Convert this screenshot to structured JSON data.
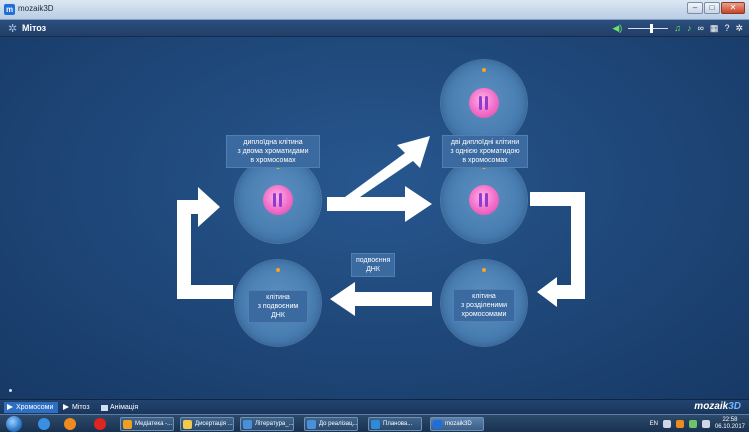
{
  "window": {
    "title": "mozaik3D",
    "min_label": "–",
    "max_label": "□",
    "close_label": "✕"
  },
  "app": {
    "heading": "Мітоз",
    "icons": {
      "settings": "gear-icon",
      "volume": "speaker-icon",
      "music": "music-note-icon",
      "link": "link-icon",
      "grid": "grid-icon",
      "help": "help-icon"
    },
    "volume_level": 0.55
  },
  "stage": {
    "labels": {
      "top_left": [
        "диплоїдна клітина",
        "з двома хроматидами",
        "в хромосомах"
      ],
      "top_right": [
        "дві диплоїдні клітини",
        "з однією хроматидою",
        "в хромосомах"
      ],
      "center": [
        "подвоєння",
        "ДНК"
      ],
      "bottom_left": [
        "клітина",
        "з подвоєним",
        "ДНК"
      ],
      "bottom_right": [
        "клітина",
        "з розділеними",
        "хромосомами"
      ]
    },
    "colors": {
      "arrow": "#ffffff",
      "nucleus": "#f26cc8",
      "chromosome": "#8f3ad0",
      "cell": "#4a7fb3",
      "marker": "#f5a623"
    }
  },
  "bottom_tabs": [
    {
      "label": "Хромосоми",
      "active": true
    },
    {
      "label": "Мітоз",
      "active": false
    },
    {
      "label": "Анімація",
      "active": false
    }
  ],
  "brand": {
    "name": "mozaik",
    "suffix": "3D"
  },
  "taskbar": {
    "tasks": [
      {
        "label": "Медіатека -...",
        "color": "#f0a020"
      },
      {
        "label": "Дисертація ...",
        "color": "#f2c94c"
      },
      {
        "label": "Література_...",
        "color": "#4a90d9"
      },
      {
        "label": "До реалізац...",
        "color": "#4a90d9"
      },
      {
        "label": "Планова...",
        "color": "#2e8bd8"
      },
      {
        "label": "mozaik3D",
        "color": "#1e6fd8"
      }
    ],
    "lang": "EN",
    "time": "22:58",
    "date": "06.10.2017"
  }
}
